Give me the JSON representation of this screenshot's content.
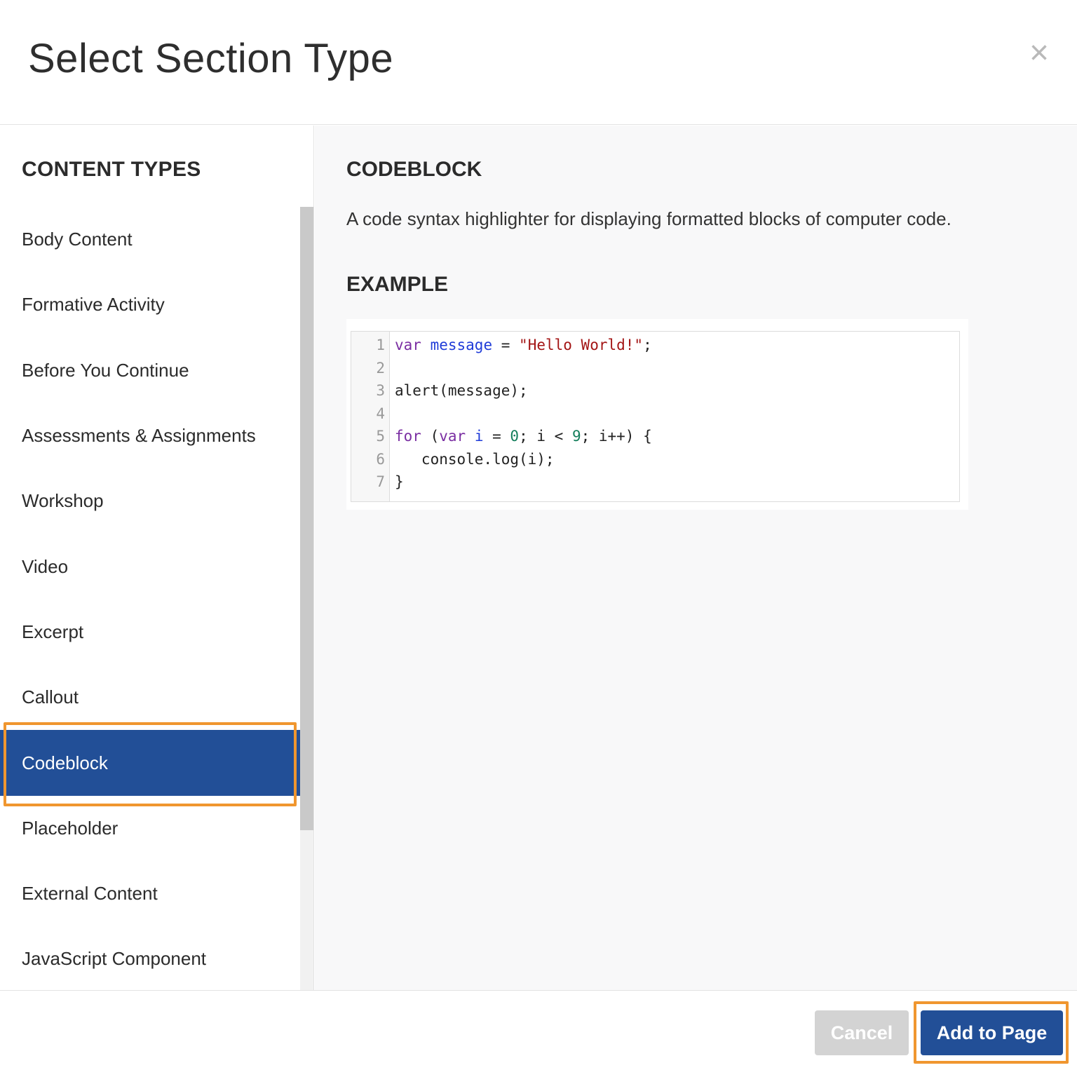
{
  "header": {
    "title": "Select Section Type",
    "close_icon": "×"
  },
  "sidebar": {
    "heading": "CONTENT TYPES",
    "items": [
      {
        "label": "Body Content"
      },
      {
        "label": "Formative Activity"
      },
      {
        "label": "Before You Continue"
      },
      {
        "label": "Assessments & Assignments"
      },
      {
        "label": "Workshop"
      },
      {
        "label": "Video"
      },
      {
        "label": "Excerpt"
      },
      {
        "label": "Callout"
      },
      {
        "label": "Codeblock",
        "selected": true
      },
      {
        "label": "Placeholder"
      },
      {
        "label": "External Content"
      },
      {
        "label": "JavaScript Component"
      }
    ]
  },
  "detail": {
    "title": "CODEBLOCK",
    "description": "A code syntax highlighter for displaying formatted blocks of computer code.",
    "example_title": "EXAMPLE",
    "code": {
      "line_numbers": [
        "1",
        "2",
        "3",
        "4",
        "5",
        "6",
        "7"
      ],
      "lines": [
        "var message = \"Hello World!\";",
        "",
        "alert(message);",
        "",
        "for (var i = 0; i < 9; i++) {",
        "   console.log(i);",
        "}"
      ]
    }
  },
  "footer": {
    "cancel_label": "Cancel",
    "add_label": "Add to Page"
  },
  "colors": {
    "accent": "#224f97",
    "highlight": "#f0962f",
    "disabled": "#d3d3d3"
  }
}
